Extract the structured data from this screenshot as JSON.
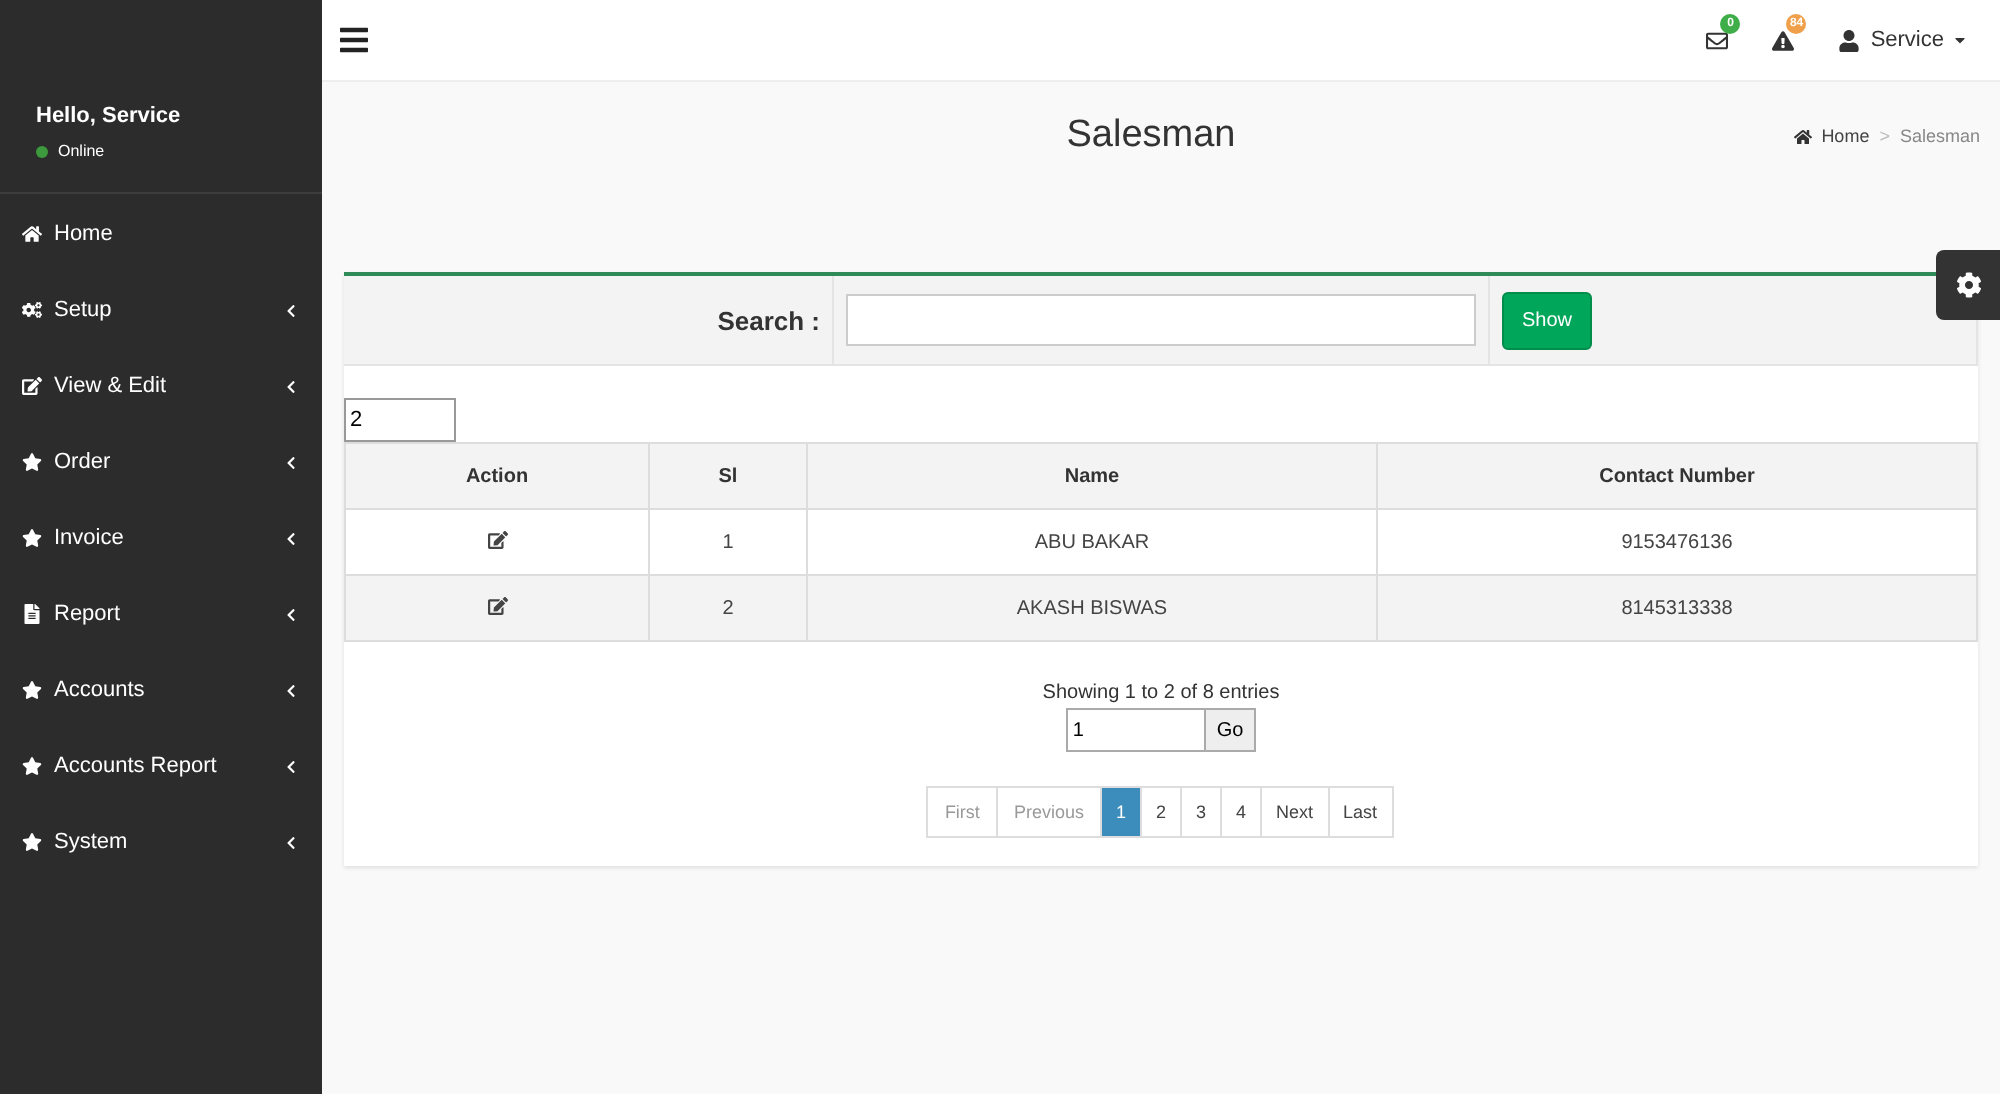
{
  "sidebar": {
    "greeting": "Hello, Service",
    "status": {
      "label": "Online",
      "color": "#3c9a3c"
    },
    "items": [
      {
        "label": "Home",
        "kind": "home",
        "has_submenu": false
      },
      {
        "label": "Setup",
        "kind": "cogs",
        "has_submenu": true
      },
      {
        "label": "View & Edit",
        "kind": "edit",
        "has_submenu": true
      },
      {
        "label": "Order",
        "kind": "star",
        "has_submenu": true
      },
      {
        "label": "Invoice",
        "kind": "star",
        "has_submenu": true
      },
      {
        "label": "Report",
        "kind": "file",
        "has_submenu": true
      },
      {
        "label": "Accounts",
        "kind": "star",
        "has_submenu": true
      },
      {
        "label": "Accounts Report",
        "kind": "star",
        "has_submenu": true
      },
      {
        "label": "System",
        "kind": "star",
        "has_submenu": true
      }
    ]
  },
  "topbar": {
    "notifications": [
      {
        "kind": "mail",
        "badge": "0",
        "color": "#3fae49"
      },
      {
        "kind": "alert",
        "badge": "84",
        "color": "#f0a04b"
      }
    ],
    "user": "Service"
  },
  "page": {
    "title": "Salesman",
    "breadcrumb": [
      {
        "label": "Home",
        "current": false
      },
      {
        "label": "Salesman",
        "current": true
      }
    ],
    "breadcrumb_separator": ">"
  },
  "search": {
    "label": "Search :",
    "button": "Show"
  },
  "page_size": "2",
  "table": {
    "columns": [
      "Action",
      "Sl",
      "Name",
      "Contact Number"
    ],
    "rows": [
      {
        "sl": "1",
        "name": "ABU BAKAR",
        "contact": "9153476136"
      },
      {
        "sl": "2",
        "name": "AKASH BISWAS",
        "contact": "8145313338"
      }
    ]
  },
  "info": "Showing 1 to 2 of 8 entries",
  "goto": {
    "value": "1",
    "button": "Go"
  },
  "pagination": [
    {
      "label": "First",
      "selected": false,
      "kind": "nav"
    },
    {
      "label": "Previous",
      "selected": false,
      "kind": "nav"
    },
    {
      "label": "1",
      "selected": true,
      "kind": "page"
    },
    {
      "label": "2",
      "selected": false,
      "kind": "page"
    },
    {
      "label": "3",
      "selected": false,
      "kind": "page"
    },
    {
      "label": "4",
      "selected": false,
      "kind": "page"
    },
    {
      "label": "Next",
      "selected": false,
      "kind": "page"
    },
    {
      "label": "Last",
      "selected": false,
      "kind": "page"
    }
  ]
}
